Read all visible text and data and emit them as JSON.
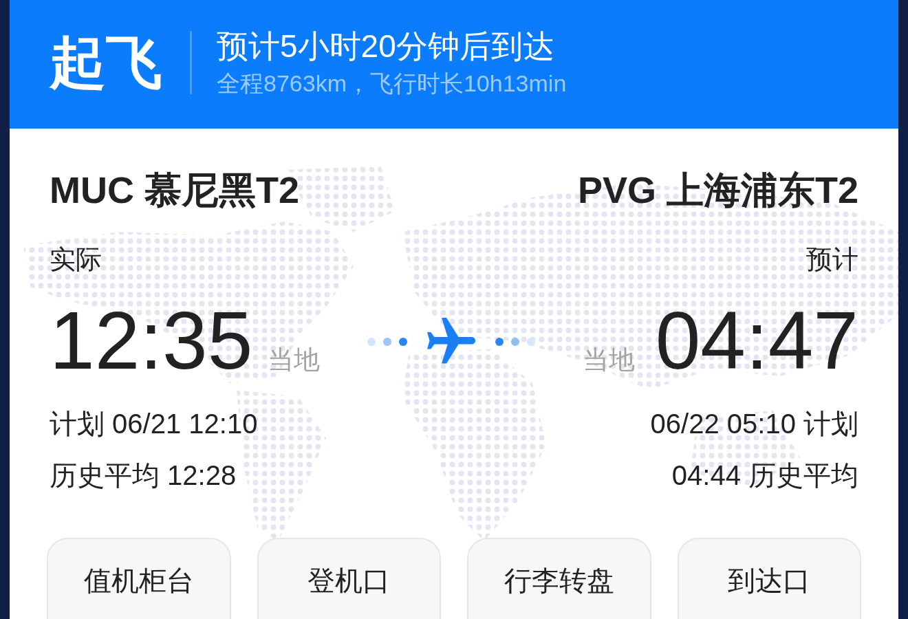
{
  "header": {
    "status": "起飞",
    "title": "预计5小时20分钟后到达",
    "subtitle": "全程8763km，飞行时长10h13min"
  },
  "departure": {
    "airport": "MUC 慕尼黑T2",
    "time_label": "实际",
    "time": "12:35",
    "zone": "当地",
    "scheduled": "计划 06/21 12:10",
    "history": "历史平均 12:28"
  },
  "arrival": {
    "airport": "PVG 上海浦东T2",
    "time_label": "预计",
    "time": "04:47",
    "zone": "当地",
    "scheduled": "06/22 05:10 计划",
    "history": "04:44 历史平均"
  },
  "buttons": [
    "值机柜台",
    "登机口",
    "行李转盘",
    "到达口"
  ]
}
